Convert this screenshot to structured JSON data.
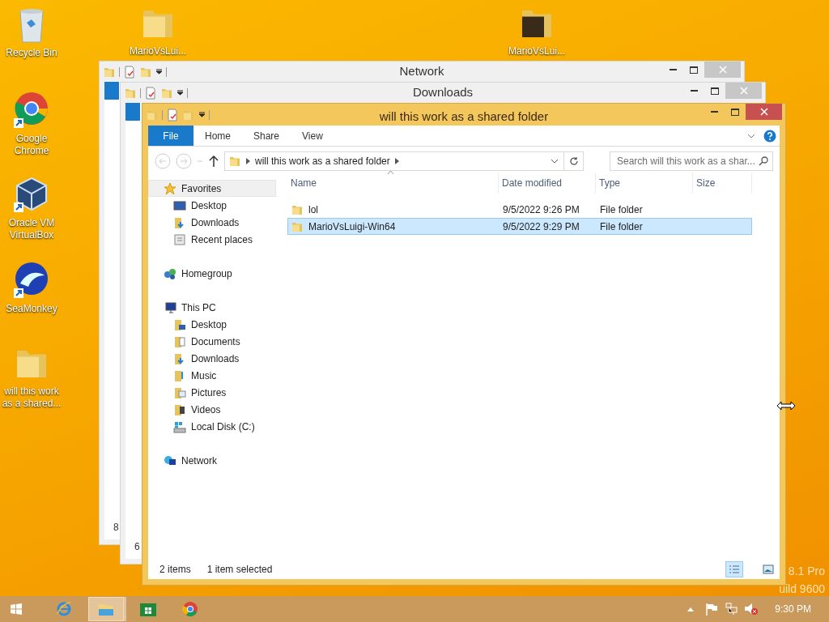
{
  "desktop_icons": [
    {
      "kind": "recycle",
      "label": "Recycle Bin"
    },
    {
      "kind": "folder",
      "label": "MarioVsLui..."
    },
    {
      "kind": "folder-dark",
      "label": "MarioVsLui..."
    },
    {
      "kind": "chrome",
      "label": "Google Chrome"
    },
    {
      "kind": "virtualbox",
      "label": "Oracle VM VirtualBox"
    },
    {
      "kind": "seamonkey",
      "label": "SeaMonkey"
    },
    {
      "kind": "folder",
      "label": "will this work as a shared..."
    }
  ],
  "background_windows": [
    {
      "title": "Network",
      "status_fragment": "8"
    },
    {
      "title": "Downloads",
      "status_fragment": "6"
    }
  ],
  "window": {
    "title": "will this work as a shared folder",
    "ribbon_tabs": [
      {
        "label": "File",
        "selected": true
      },
      {
        "label": "Home",
        "selected": false
      },
      {
        "label": "Share",
        "selected": false
      },
      {
        "label": "View",
        "selected": false
      }
    ],
    "address": "will this work as a shared folder",
    "search": {
      "placeholder": "Search will this work as a shar..."
    },
    "nav": [
      {
        "label": "Favorites",
        "kind": "star",
        "selected": true,
        "children": [
          {
            "label": "Desktop",
            "kind": "desktop",
            "selected": false
          },
          {
            "label": "Downloads",
            "kind": "downloads",
            "selected": false
          },
          {
            "label": "Recent places",
            "kind": "recent",
            "selected": false
          }
        ]
      },
      {
        "label": "Homegroup",
        "kind": "homegroup",
        "selected": false
      },
      {
        "label": "This PC",
        "kind": "pc",
        "selected": false,
        "children": [
          {
            "label": "Desktop",
            "kind": "desktop-folder",
            "selected": false
          },
          {
            "label": "Documents",
            "kind": "documents",
            "selected": false
          },
          {
            "label": "Downloads",
            "kind": "downloads",
            "selected": false
          },
          {
            "label": "Music",
            "kind": "music",
            "selected": false
          },
          {
            "label": "Pictures",
            "kind": "pictures",
            "selected": false
          },
          {
            "label": "Videos",
            "kind": "videos",
            "selected": false
          },
          {
            "label": "Local Disk (C:)",
            "kind": "disk",
            "selected": false
          }
        ]
      },
      {
        "label": "Network",
        "kind": "network",
        "selected": false
      }
    ],
    "columns": [
      "Name",
      "Date modified",
      "Type",
      "Size"
    ],
    "rows": [
      {
        "name": "lol",
        "date": "9/5/2022 9:26 PM",
        "type": "File folder",
        "selected": false
      },
      {
        "name": "MarioVsLuigi-Win64",
        "date": "9/5/2022 9:29 PM",
        "type": "File folder",
        "selected": true
      }
    ],
    "status_bar": {
      "count": "2 items",
      "selection": "1 item selected"
    },
    "views": [
      {
        "kind": "details",
        "selected": true
      },
      {
        "kind": "large-icons",
        "selected": false
      }
    ]
  },
  "os_edition": [
    "8.1 Pro",
    "uild 9600"
  ],
  "taskbar": {
    "apps": [
      {
        "kind": "ie",
        "active": false
      },
      {
        "kind": "explorer",
        "active": true
      },
      {
        "kind": "store",
        "active": false
      },
      {
        "kind": "chrome",
        "active": false
      }
    ],
    "clock": "9:30 PM"
  }
}
